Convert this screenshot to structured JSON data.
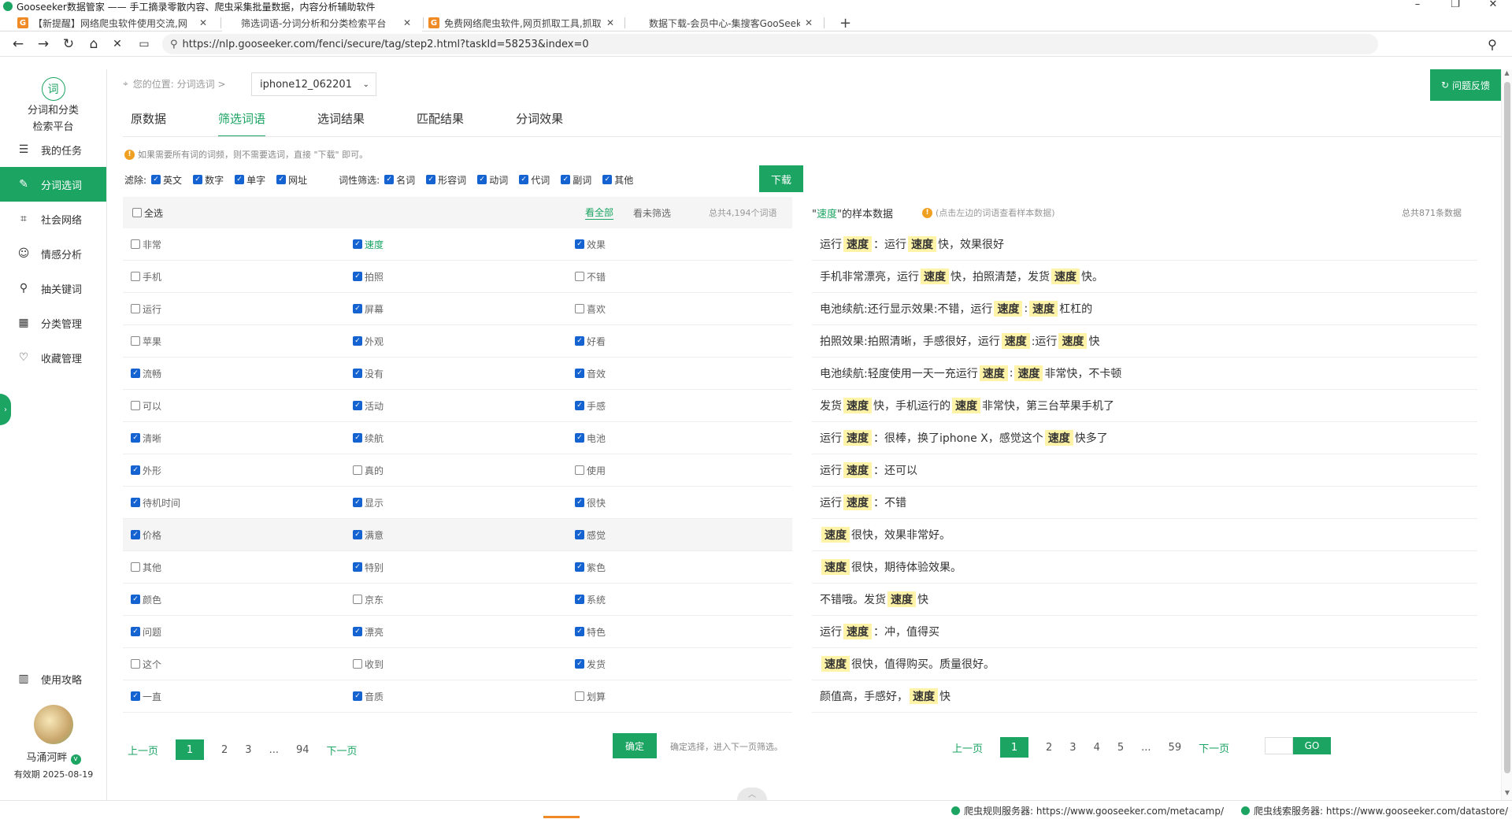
{
  "window": {
    "title": "Gooseeker数据管家 —— 手工摘录零散内容、爬虫采集批量数据，内容分析辅助软件"
  },
  "tabs": [
    {
      "label": "【新提醒】网络爬虫软件使用交流,网",
      "favicon": "G"
    },
    {
      "label": "筛选词语-分词分析和分类检索平台",
      "favicon": ""
    },
    {
      "label": "免费网络爬虫软件,网页抓取工具,抓取",
      "favicon": "G"
    },
    {
      "label": "数据下载-会员中心-集搜客GooSeeke",
      "favicon": ""
    }
  ],
  "url": "https://nlp.gooseeker.com/fenci/secure/tag/step2.html?taskId=58253&index=0",
  "sidebar": {
    "brand": [
      "分词和分类",
      "检索平台"
    ],
    "brand_icon": "词",
    "items": [
      {
        "label": "我的任务",
        "icon": "list-icon"
      },
      {
        "label": "分词选词",
        "icon": "edit-icon",
        "active": true
      },
      {
        "label": "社会网络",
        "icon": "network-icon"
      },
      {
        "label": "情感分析",
        "icon": "smile-icon"
      },
      {
        "label": "抽关键词",
        "icon": "search-icon"
      },
      {
        "label": "分类管理",
        "icon": "grid-icon"
      },
      {
        "label": "收藏管理",
        "icon": "heart-icon"
      }
    ],
    "guide": "使用攻略",
    "user": {
      "name": "马涌河畔",
      "badge": "v",
      "expire": "有效期 2025-08-19"
    }
  },
  "header": {
    "crumb": "您的位置: 分词选词 >",
    "task": "iphone12_062201",
    "feedback": "问题反馈"
  },
  "main_tabs": [
    "原数据",
    "筛选词语",
    "选词结果",
    "匹配结果",
    "分词效果"
  ],
  "hint": "如果需要所有词的词频，则不需要选词，直接 \"下载\" 即可。",
  "filters": {
    "exclude_label": "滤除:",
    "exclude": [
      "英文",
      "数字",
      "单字",
      "网址"
    ],
    "pos_label": "词性筛选:",
    "pos": [
      "名词",
      "形容词",
      "动词",
      "代词",
      "副词",
      "其他"
    ],
    "download": "下载"
  },
  "word_table": {
    "select_all": "全选",
    "view_all": "看全部",
    "view_unfiltered": "看未筛选",
    "total": "总共4,194个词语",
    "rows": [
      [
        {
          "w": "非常",
          "c": false
        },
        {
          "w": "速度",
          "c": true,
          "sel": true
        },
        {
          "w": "效果",
          "c": true
        }
      ],
      [
        {
          "w": "手机",
          "c": false
        },
        {
          "w": "拍照",
          "c": true
        },
        {
          "w": "不错",
          "c": false
        }
      ],
      [
        {
          "w": "运行",
          "c": false
        },
        {
          "w": "屏幕",
          "c": true
        },
        {
          "w": "喜欢",
          "c": false
        }
      ],
      [
        {
          "w": "苹果",
          "c": false
        },
        {
          "w": "外观",
          "c": true
        },
        {
          "w": "好看",
          "c": true
        }
      ],
      [
        {
          "w": "流畅",
          "c": true
        },
        {
          "w": "没有",
          "c": true
        },
        {
          "w": "音效",
          "c": true
        }
      ],
      [
        {
          "w": "可以",
          "c": false
        },
        {
          "w": "活动",
          "c": true
        },
        {
          "w": "手感",
          "c": true
        }
      ],
      [
        {
          "w": "清晰",
          "c": true
        },
        {
          "w": "续航",
          "c": true
        },
        {
          "w": "电池",
          "c": true
        }
      ],
      [
        {
          "w": "外形",
          "c": true
        },
        {
          "w": "真的",
          "c": false
        },
        {
          "w": "使用",
          "c": false
        }
      ],
      [
        {
          "w": "待机时间",
          "c": true
        },
        {
          "w": "显示",
          "c": true
        },
        {
          "w": "很快",
          "c": true
        }
      ],
      [
        {
          "w": "价格",
          "c": true
        },
        {
          "w": "满意",
          "c": true
        },
        {
          "w": "感觉",
          "c": true
        }
      ],
      [
        {
          "w": "其他",
          "c": false
        },
        {
          "w": "特别",
          "c": true
        },
        {
          "w": "紫色",
          "c": true
        }
      ],
      [
        {
          "w": "颜色",
          "c": true
        },
        {
          "w": "京东",
          "c": false
        },
        {
          "w": "系统",
          "c": true
        }
      ],
      [
        {
          "w": "问题",
          "c": true
        },
        {
          "w": "漂亮",
          "c": true
        },
        {
          "w": "特色",
          "c": true
        }
      ],
      [
        {
          "w": "这个",
          "c": false
        },
        {
          "w": "收到",
          "c": false
        },
        {
          "w": "发货",
          "c": true
        }
      ],
      [
        {
          "w": "一直",
          "c": true
        },
        {
          "w": "音质",
          "c": true
        },
        {
          "w": "划算",
          "c": false
        }
      ]
    ],
    "pager": {
      "prev": "上一页",
      "pages": [
        "1",
        "2",
        "3",
        "...",
        "94"
      ],
      "current": "1",
      "next": "下一页"
    },
    "confirm": "确定",
    "confirm_hint": "确定选择，进入下一页筛选。"
  },
  "sample": {
    "title_prefix": "\"",
    "keyword": "速度",
    "title_suffix": "\"的样本数据",
    "tip": "(点击左边的词语查看样本数据)",
    "total": "总共871条数据",
    "rows": [
      [
        "运行",
        "[速度]",
        "：运行",
        "[速度]",
        "快，效果很好"
      ],
      [
        "手机非常漂亮，运行",
        "[速度]",
        "快，拍照清楚，发货",
        "[速度]",
        "快。"
      ],
      [
        "电池续航:还行显示效果:不错，运行",
        "[速度]",
        ":",
        "[速度]",
        "杠杠的"
      ],
      [
        "拍照效果:拍照清晰，手感很好，运行",
        "[速度]",
        ":运行",
        "[速度]",
        "快"
      ],
      [
        "电池续航:轻度使用一天一充运行",
        "[速度]",
        ":",
        "[速度]",
        "非常快，不卡顿"
      ],
      [
        "发货",
        "[速度]",
        "快，手机运行的",
        "[速度]",
        "非常快，第三台苹果手机了"
      ],
      [
        "运行",
        "[速度]",
        "：很棒，换了iphone X，感觉这个",
        "[速度]",
        "快多了"
      ],
      [
        "运行",
        "[速度]",
        "：还可以"
      ],
      [
        "运行",
        "[速度]",
        "：不错"
      ],
      [
        "",
        "[速度]",
        "很快，效果非常好。"
      ],
      [
        "",
        "[速度]",
        "很快，期待体验效果。"
      ],
      [
        "不错哦。发货",
        "[速度]",
        "快"
      ],
      [
        "运行",
        "[速度]",
        "：冲，值得买"
      ],
      [
        "",
        "[速度]",
        "很快，值得购买。质量很好。"
      ],
      [
        "颜值高，手感好，",
        "[速度]",
        "快"
      ]
    ],
    "pager": {
      "prev": "上一页",
      "pages": [
        "1",
        "2",
        "3",
        "4",
        "5",
        "...",
        "59"
      ],
      "current": "1",
      "next": "下一页"
    },
    "go": "GO"
  },
  "status": {
    "rule_server": "爬虫规则服务器: https://www.gooseeker.com/metacamp/",
    "clue_server": "爬虫线索服务器: https://www.gooseeker.com/datastore/"
  },
  "colors": {
    "accent": "#1ba462",
    "checkbox": "#1463d1",
    "highlight": "#fff3a8"
  }
}
